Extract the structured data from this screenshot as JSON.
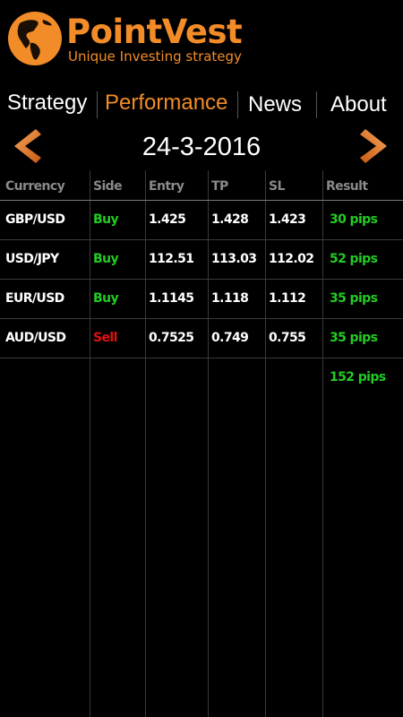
{
  "brand": {
    "name": "PointVest",
    "tagline": "Unique Investing strategy",
    "accent_color": "#f28c28"
  },
  "nav": {
    "items": [
      {
        "label": "Strategy",
        "active": false
      },
      {
        "label": "Performance",
        "active": true
      },
      {
        "label": "News",
        "active": false
      },
      {
        "label": "About",
        "active": false
      }
    ]
  },
  "date_bar": {
    "date": "24-3-2016",
    "prev_icon": "chevron-left-icon",
    "next_icon": "chevron-right-icon"
  },
  "table": {
    "headers": [
      "Currency",
      "Side",
      "Entry",
      "TP",
      "SL",
      "Result"
    ],
    "rows": [
      {
        "currency": "GBP/USD",
        "side": "Buy",
        "entry": "1.425",
        "tp": "1.428",
        "sl": "1.423",
        "result": "30 pips"
      },
      {
        "currency": "USD/JPY",
        "side": "Buy",
        "entry": "112.51",
        "tp": "113.03",
        "sl": "112.02",
        "result": "52 pips"
      },
      {
        "currency": "EUR/USD",
        "side": "Buy",
        "entry": "1.1145",
        "tp": "1.118",
        "sl": "1.112",
        "result": "35 pips"
      },
      {
        "currency": "AUD/USD",
        "side": "Sell",
        "entry": "0.7525",
        "tp": "0.749",
        "sl": "0.755",
        "result": "35 pips"
      }
    ],
    "total": "152 pips",
    "colors": {
      "buy": "#22cc22",
      "sell": "#e01010",
      "result": "#22cc22",
      "header": "#8a8a8a"
    }
  }
}
